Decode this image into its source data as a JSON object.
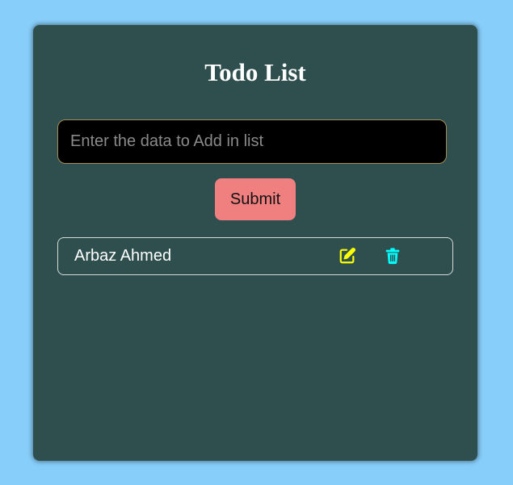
{
  "app": {
    "title": "Todo List"
  },
  "form": {
    "input_placeholder": "Enter the data to Add in list",
    "input_value": "",
    "submit_label": "Submit"
  },
  "todos": [
    {
      "text": "Arbaz Ahmed",
      "edit_icon": "edit-icon",
      "delete_icon": "trash-icon"
    }
  ],
  "colors": {
    "page_background": "#87cefa",
    "card_background": "#2f4f4f",
    "submit_button": "#f08080",
    "edit_icon": "#ffff00",
    "delete_icon": "#00ffff"
  }
}
